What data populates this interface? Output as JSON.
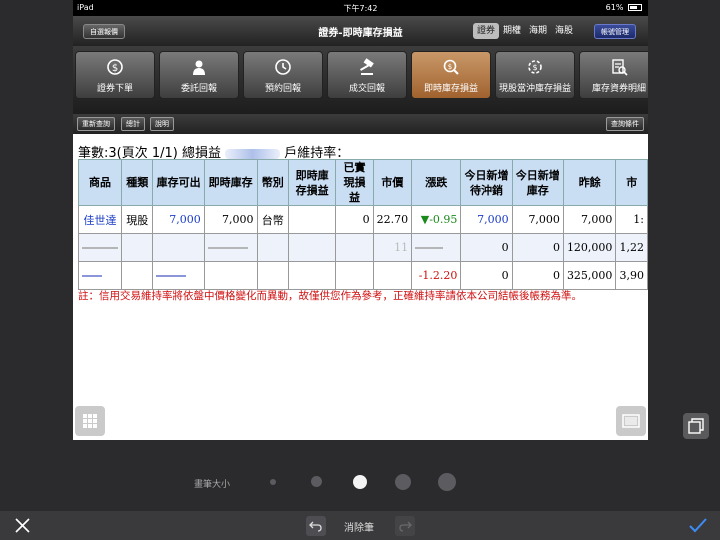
{
  "statusbar": {
    "device": "iPad",
    "time": "下午7:42",
    "battery": "61%"
  },
  "navbar": {
    "left_button": "自選報價",
    "title": "證券-即時庫存損益",
    "segments": [
      "證券",
      "期權",
      "海期",
      "海股"
    ],
    "active_segment": "證券",
    "right_button": "帳號管理"
  },
  "functions": [
    {
      "label": "證券下單",
      "icon": "dollar-cycle-icon",
      "active": false
    },
    {
      "label": "委託回報",
      "icon": "person-icon",
      "active": false
    },
    {
      "label": "預約回報",
      "icon": "clock-icon",
      "active": false
    },
    {
      "label": "成交回報",
      "icon": "gavel-icon",
      "active": false
    },
    {
      "label": "即時庫存損益",
      "icon": "money-search-icon",
      "active": true
    },
    {
      "label": "現股當沖庫存損益",
      "icon": "dollar-gear-icon",
      "active": false
    },
    {
      "label": "庫存資券明細",
      "icon": "document-search-icon",
      "active": false
    }
  ],
  "toolbar": {
    "refresh": "重新查詢",
    "total": "總計",
    "help": "說明",
    "query_conditions": "查詢條件"
  },
  "summary": {
    "count_label": "筆數:3(頁次 1/1) 總損益",
    "maintenance_label": "戶維持率："
  },
  "table": {
    "headers": [
      "商品",
      "種類",
      "庫存可出",
      "即時庫存",
      "幣別",
      "即時庫存損益",
      "已實現損益",
      "市價",
      "漲跌",
      "今日新增待沖銷",
      "今日新增庫存",
      "昨餘",
      "市"
    ],
    "rows": [
      [
        "佳世達",
        "現股",
        "7,000",
        "7,000",
        "台幣",
        "",
        "0",
        "22.70",
        "-0.95",
        "7,000",
        "7,000",
        "7,000",
        "1:"
      ],
      [
        "",
        "",
        "",
        "",
        "",
        "",
        "",
        "11",
        "",
        "0",
        "0",
        "120,000",
        "1,22"
      ],
      [
        "",
        "",
        "",
        "",
        "",
        "",
        "",
        "",
        "-1.2.20",
        "0",
        "0",
        "325,000",
        "3,90"
      ]
    ],
    "change_arrow": "▼"
  },
  "notice": "註：信用交易維持率將依盤中價格變化而異動，故僅供您作為參考，正確維持率請依本公司結帳後帳務為準。",
  "drawing": {
    "pen_size_label": "畫筆大小",
    "clear_label": "消除筆",
    "selected_pen_size_index": 2
  },
  "colors": {
    "accent_active": "#b87a45",
    "header_bg": "#c9ddf3",
    "notice_red": "#d01010",
    "down_green": "#1a8a1a"
  }
}
